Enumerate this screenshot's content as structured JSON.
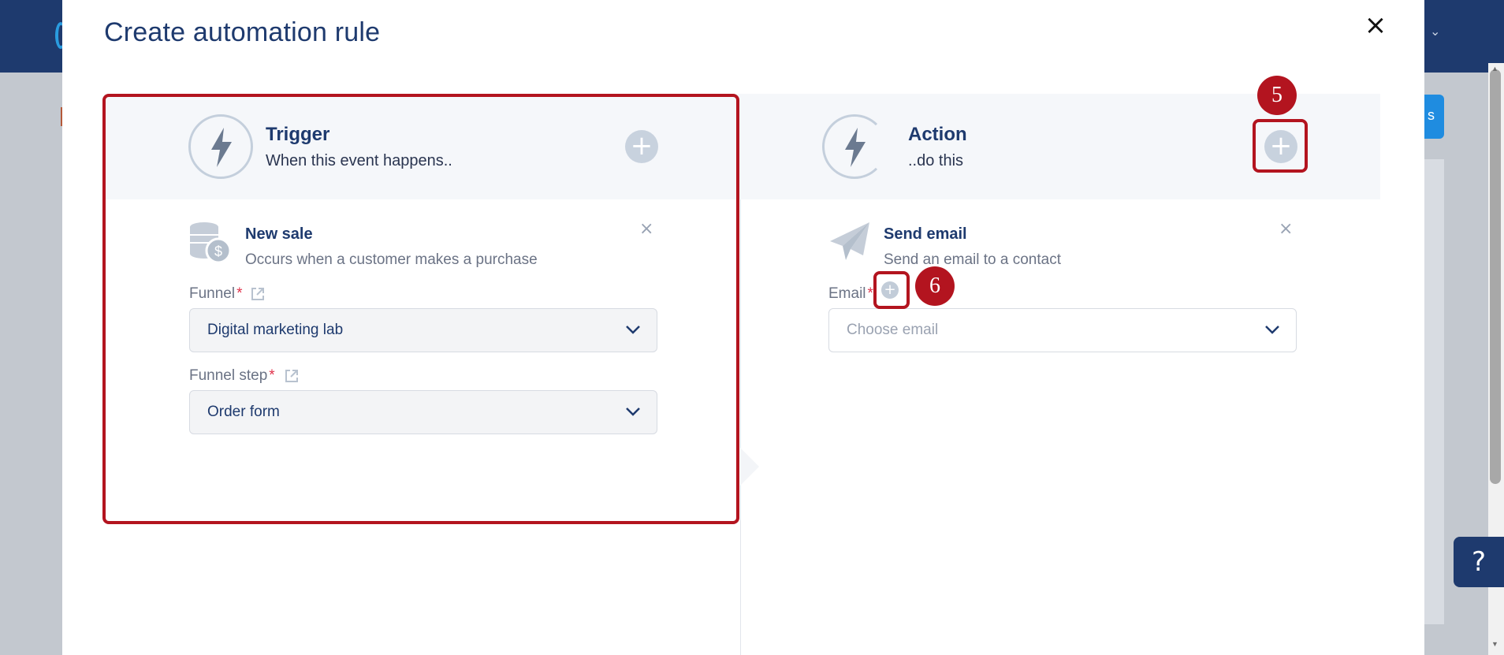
{
  "modal": {
    "title": "Create automation rule",
    "close_label": "×"
  },
  "trigger": {
    "title": "Trigger",
    "subtitle": "When this event happens..",
    "add_label": "+",
    "step": {
      "title": "New sale",
      "description": "Occurs when a customer makes a purchase",
      "remove_label": "×"
    },
    "fields": [
      {
        "label": "Funnel",
        "required_mark": "*",
        "value": "Digital marketing lab"
      },
      {
        "label": "Funnel step",
        "required_mark": "*",
        "value": "Order form"
      }
    ]
  },
  "action": {
    "title": "Action",
    "subtitle": "..do this",
    "add_label": "+",
    "step": {
      "title": "Send email",
      "description": "Send an email to a contact",
      "remove_label": "×"
    },
    "email_field": {
      "label": "Email",
      "required_mark": "*",
      "add_label": "+",
      "placeholder": "Choose email"
    }
  },
  "annotations": {
    "badge_5": "5",
    "badge_6": "6"
  },
  "background": {
    "blue_button_fragment": "s",
    "help_label": "?",
    "header_chevron": "⌄"
  },
  "colors": {
    "primary": "#1e3a6e",
    "annotation_red": "#b3141f",
    "required_red": "#e0334c",
    "icon_gray": "#c8d2de"
  },
  "icons": {
    "trigger": "lightning-bolt-icon",
    "action": "lightning-bolt-cycle-icon",
    "new_sale": "coins-dollar-icon",
    "send_email": "paper-plane-icon",
    "external_link": "external-link-icon",
    "dropdown": "chevron-down-icon"
  }
}
